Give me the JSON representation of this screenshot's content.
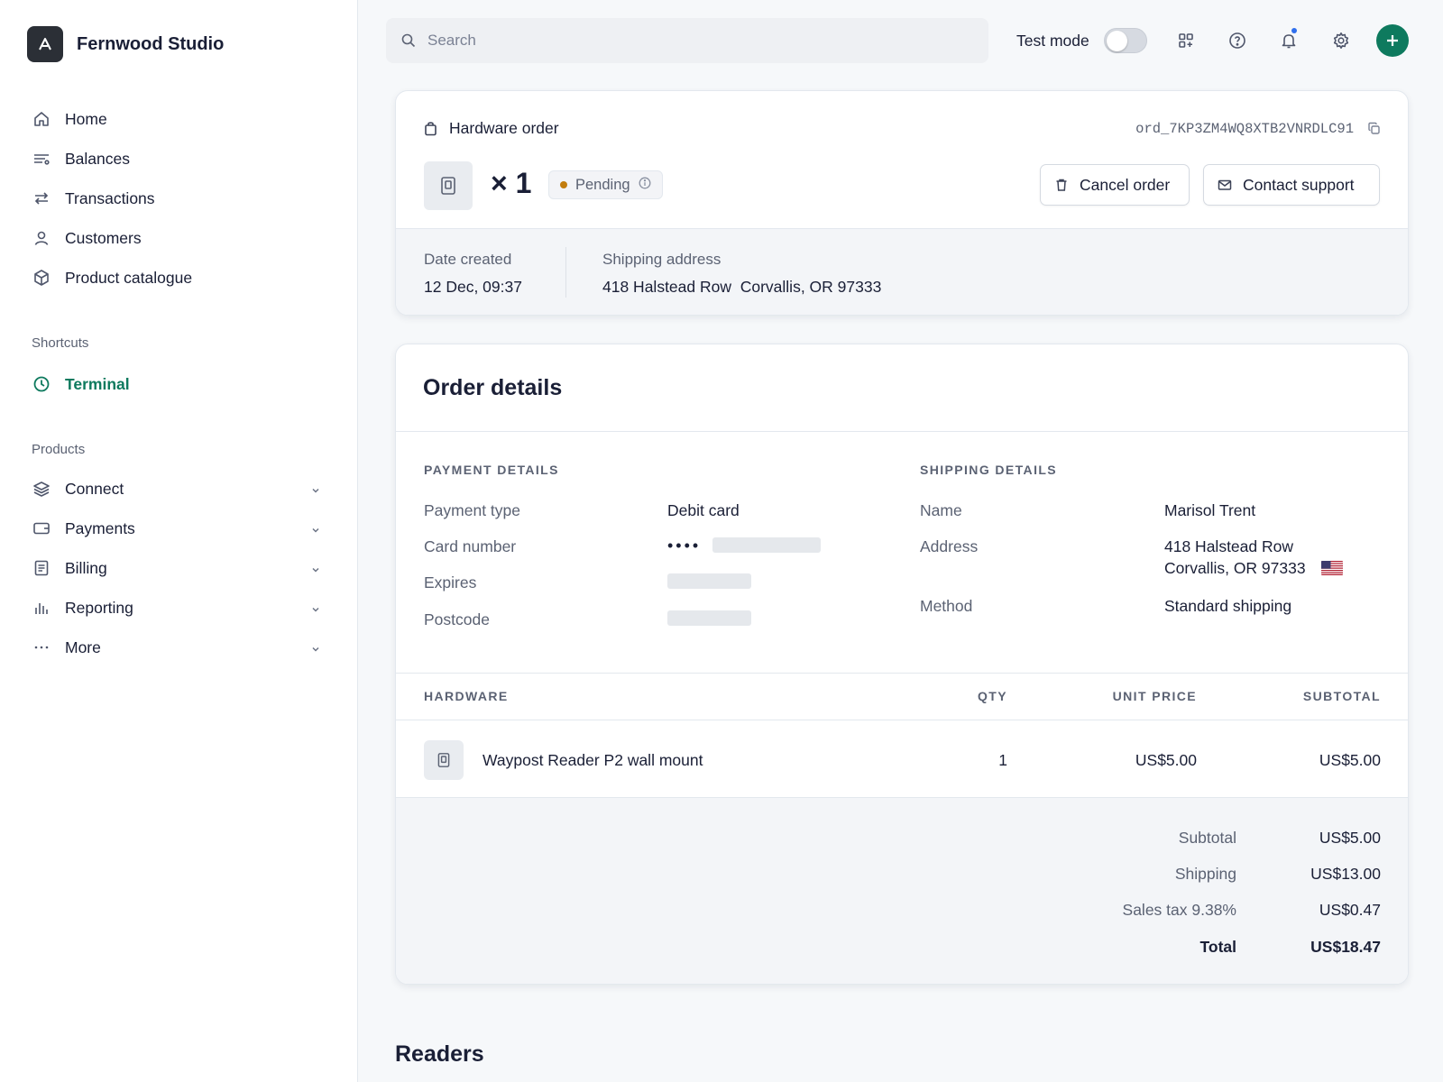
{
  "brand": {
    "name": "Fernwood Studio",
    "logo_icon": "logo-a-icon",
    "logo_color": "#2b2f36"
  },
  "nav": {
    "main": [
      {
        "label": "Home",
        "icon": "home-icon"
      },
      {
        "label": "Balances",
        "icon": "balances-icon"
      },
      {
        "label": "Transactions",
        "icon": "arrows-icon"
      },
      {
        "label": "Customers",
        "icon": "person-icon"
      },
      {
        "label": "Product catalogue",
        "icon": "box-icon"
      }
    ],
    "shortcuts_title": "Shortcuts",
    "shortcuts": [
      {
        "label": "Terminal",
        "icon": "clock-icon",
        "active": true
      }
    ],
    "products_title": "Products",
    "products": [
      {
        "label": "Connect",
        "icon": "layers-icon"
      },
      {
        "label": "Payments",
        "icon": "wallet-icon"
      },
      {
        "label": "Billing",
        "icon": "document-icon"
      },
      {
        "label": "Reporting",
        "icon": "bar-chart-icon"
      },
      {
        "label": "More",
        "icon": "ellipsis-icon"
      }
    ]
  },
  "topbar": {
    "search_placeholder": "Search",
    "test_mode_label": "Test mode",
    "test_mode_on": false
  },
  "order": {
    "title": "Hardware order",
    "id": "ord_7KP3ZM4WQ8XTB2VNRDLC91",
    "quantity": "× 1",
    "status": "Pending",
    "cancel_label": "Cancel order",
    "contact_label": "Contact support",
    "date_label": "Date created",
    "date_value": "12 Dec, 09:37",
    "shipping_label": "Shipping address",
    "shipping_value": "418 Halstead Row  Corvallis, OR 97333"
  },
  "details": {
    "title": "Order details",
    "payment": {
      "heading": "PAYMENT DETAILS",
      "type_label": "Payment type",
      "type_value": "Debit card",
      "card_label": "Card number",
      "card_mask": "••••",
      "expires_label": "Expires",
      "postcode_label": "Postcode"
    },
    "shipping": {
      "heading": "SHIPPING DETAILS",
      "name_label": "Name",
      "name_value": "Marisol Trent",
      "address_label": "Address",
      "address_line1": "418 Halstead Row",
      "address_line2": "Corvallis, OR 97333",
      "method_label": "Method",
      "method_value": "Standard shipping"
    },
    "table": {
      "headers": [
        "HARDWARE",
        "QTY",
        "UNIT PRICE",
        "SUBTOTAL"
      ],
      "rows": [
        {
          "name": "Waypost Reader P2 wall mount",
          "qty": "1",
          "unit_price": "US$5.00",
          "subtotal": "US$5.00"
        }
      ]
    },
    "totals": [
      {
        "label": "Subtotal",
        "value": "US$5.00"
      },
      {
        "label": "Shipping",
        "value": "US$13.00"
      },
      {
        "label": "Sales tax 9.38%",
        "value": "US$0.47"
      },
      {
        "label": "Total",
        "value": "US$18.47"
      }
    ]
  },
  "readers_title": "Readers",
  "colors": {
    "accent": "#0e7a5e",
    "pending": "#c27d0e",
    "notification": "#2f6fed"
  }
}
